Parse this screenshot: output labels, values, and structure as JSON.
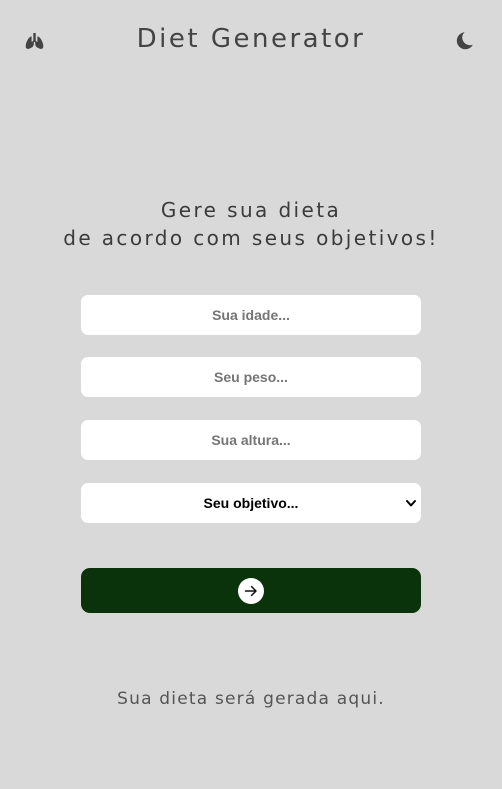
{
  "header": {
    "title": "Diet Generator",
    "logo_icon": "lungs-icon",
    "theme_icon": "moon-icon"
  },
  "hero": {
    "line1": "Gere sua dieta",
    "line2": "de acordo com seus objetivos!"
  },
  "form": {
    "age_placeholder": "Sua idade...",
    "weight_placeholder": "Seu peso...",
    "height_placeholder": "Sua altura...",
    "goal_selected": "Seu objetivo...",
    "submit_icon": "arrow-right-icon"
  },
  "result": {
    "text": "Sua dieta será gerada aqui."
  },
  "colors": {
    "background": "#d9d9d9",
    "button": "#0a330c",
    "text": "#444444",
    "field_bg": "#ffffff"
  }
}
